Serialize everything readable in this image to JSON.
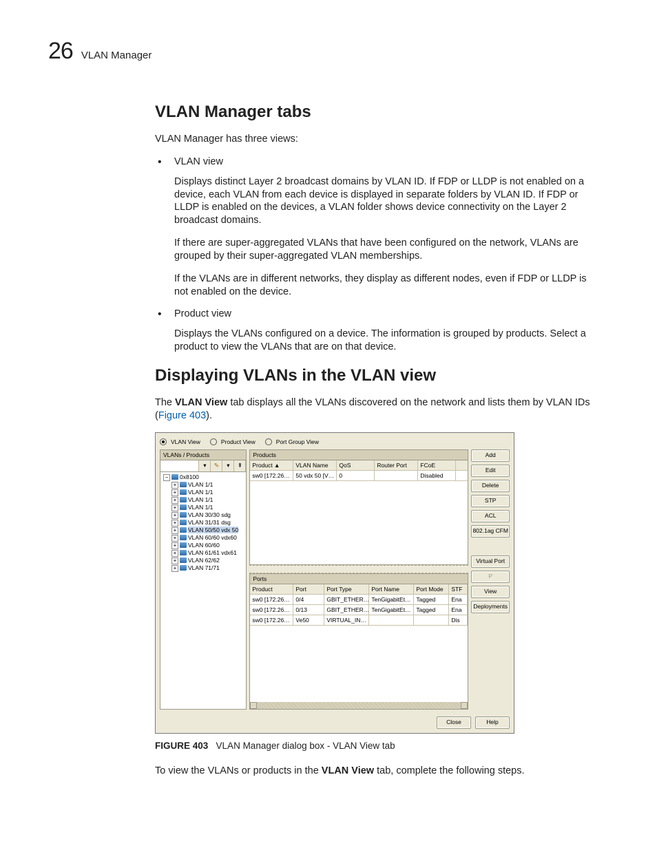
{
  "page": {
    "number": "26",
    "header": "VLAN Manager"
  },
  "sections": {
    "tabs_heading": "VLAN Manager tabs",
    "intro_para": "VLAN Manager has three views:",
    "bullets": [
      {
        "title": "VLAN view",
        "paras": [
          "Displays distinct Layer 2 broadcast domains by VLAN ID. If FDP or LLDP is not enabled on a device, each VLAN from each device is displayed in separate folders by VLAN ID. If FDP or LLDP is enabled on the devices, a VLAN folder shows device connectivity on the Layer 2 broadcast domains.",
          "If there are super-aggregated VLANs that have been configured on the network, VLANs are grouped by their super-aggregated VLAN memberships.",
          "If the VLANs are in different networks, they display as different nodes, even if FDP or LLDP is not enabled on the device."
        ]
      },
      {
        "title": "Product view",
        "paras": [
          "Displays the VLANs configured on a device. The information is grouped by products. Select a product to view the VLANs that are on that device."
        ]
      }
    ],
    "display_heading": "Displaying VLANs in the VLAN view",
    "display_para_pre": "The ",
    "display_para_bold": "VLAN View",
    "display_para_post": " tab displays all the VLANs discovered on the network and lists them by VLAN IDs (",
    "display_para_link": "Figure 403",
    "display_para_end": ").",
    "closing_pre": "To view the VLANs or products in the ",
    "closing_bold": "VLAN View",
    "closing_post": " tab, complete the following steps."
  },
  "figure": {
    "label": "FIGURE 403",
    "caption": "VLAN Manager dialog box - VLAN View tab"
  },
  "dlg": {
    "radios": {
      "vlan": "VLAN View",
      "product": "Product View",
      "portgroup": "Port Group View"
    },
    "tree_head": "VLANs / Products",
    "tree_root": "0x8100",
    "tree_items": [
      "VLAN 1/1",
      "VLAN 1/1",
      "VLAN 1/1",
      "VLAN 1/1",
      "VLAN 30/30 sdg",
      "VLAN 31/31 dsg",
      "VLAN 50/50 vdx 50",
      "VLAN 60/60 vdx60",
      "VLAN 60/60",
      "VLAN 61/61 vdx61",
      "VLAN 62/62",
      "VLAN 71/71"
    ],
    "tree_selected_index": 6,
    "products_head": "Products",
    "products_cols": [
      "Product ▲",
      "VLAN Name",
      "QoS",
      "Router Port",
      "FCoE"
    ],
    "products_row": [
      "sw0 [172.26…",
      "50 vdx 50 [V…",
      "0",
      "",
      "Disabled"
    ],
    "ports_head": "Ports",
    "ports_cols": [
      "Product",
      "Port",
      "Port Type",
      "Port Name",
      "Port Mode",
      "STF"
    ],
    "ports_rows": [
      [
        "sw0 [172.26…",
        "0/4",
        "GBIT_ETHER…",
        "TenGigabitEt…",
        "Tagged",
        "Ena"
      ],
      [
        "sw0 [172.26…",
        "0/13",
        "GBIT_ETHER…",
        "TenGigabitEt…",
        "Tagged",
        "Ena"
      ],
      [
        "sw0 [172.26…",
        "Ve50",
        "VIRTUAL_IN…",
        "",
        "",
        "Dis"
      ]
    ],
    "buttons": {
      "add": "Add",
      "edit": "Edit",
      "delete": "Delete",
      "stp": "STP",
      "acl": "ACL",
      "cfm": "802.1ag CFM",
      "vport": "Virtual Port",
      "p": "P",
      "view": "View",
      "deploy": "Deployments",
      "close": "Close",
      "help": "Help"
    }
  }
}
